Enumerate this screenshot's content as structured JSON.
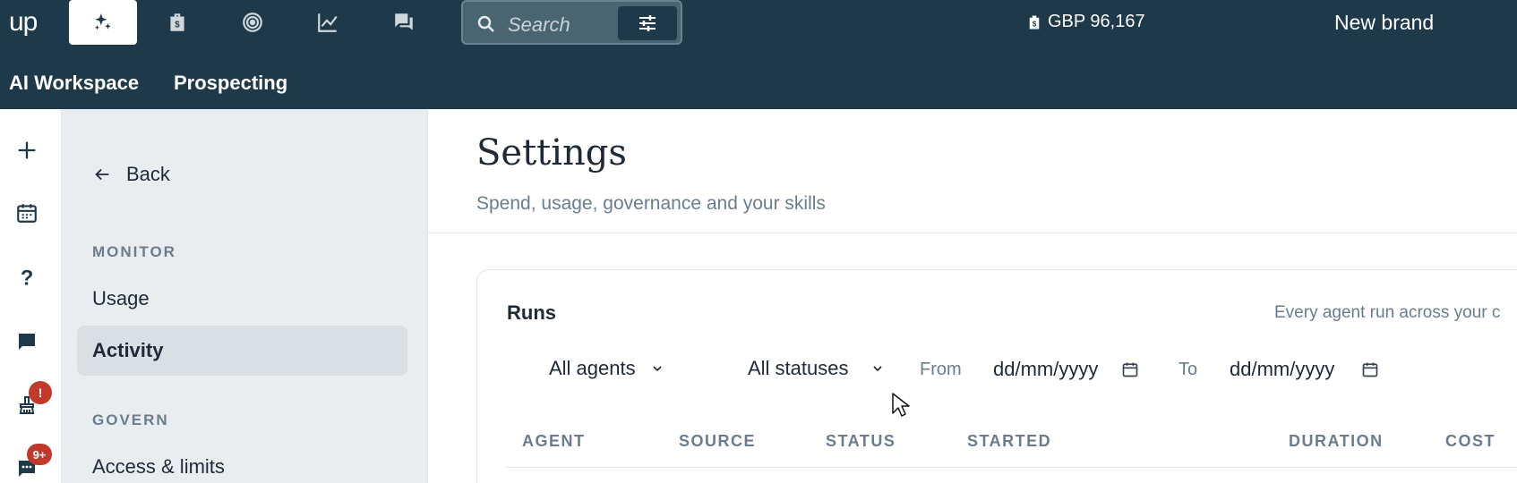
{
  "topbar": {
    "logo": "up",
    "nav_icons": [
      "sparkles-icon",
      "briefcase-icon",
      "target-icon",
      "chart-line-icon",
      "chat-bubbles-icon"
    ],
    "search_placeholder": "Search",
    "balance": "GBP 96,167",
    "brand": "New brand"
  },
  "subnav": {
    "items": [
      "AI Workspace",
      "Prospecting"
    ]
  },
  "rail": {
    "badges": {
      "alert": "!",
      "messages": "9+"
    }
  },
  "sidebar": {
    "back_label": "Back",
    "monitor_section": "MONITOR",
    "monitor_items": [
      "Usage",
      "Activity"
    ],
    "govern_section": "GOVERN",
    "govern_items": [
      "Access & limits"
    ]
  },
  "main": {
    "title": "Settings",
    "subtitle": "Spend, usage, governance and your skills",
    "card": {
      "title": "Runs",
      "description": "Every agent run across your c",
      "agent_filter": "All agents",
      "status_filter": "All statuses",
      "from_label": "From",
      "from_value": "dd/mm/yyyy",
      "to_label": "To",
      "to_value": "dd/mm/yyyy",
      "columns": [
        "AGENT",
        "SOURCE",
        "STATUS",
        "STARTED",
        "DURATION",
        "COST"
      ]
    }
  },
  "colors": {
    "topbar_bg": "#1e3a4a",
    "sidebar_bg": "#e9edf0",
    "badge": "#c0392b"
  }
}
